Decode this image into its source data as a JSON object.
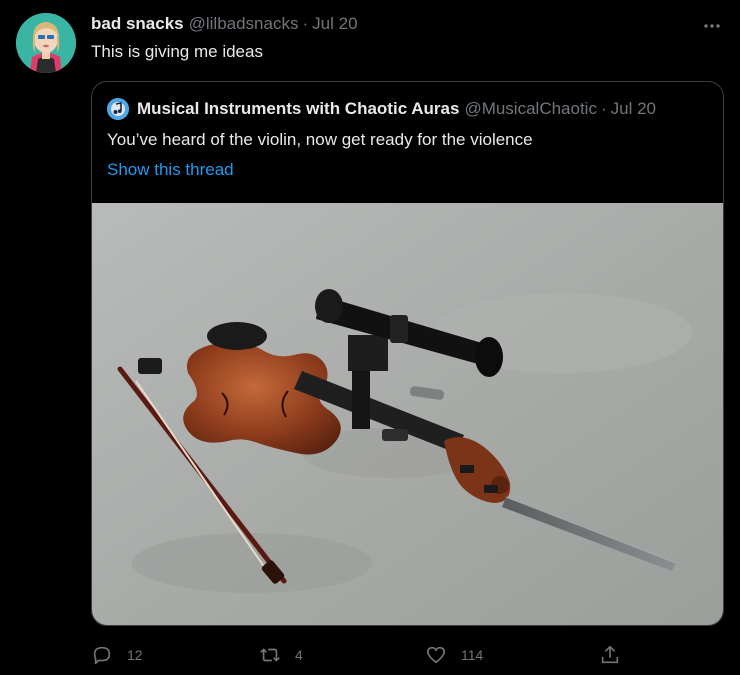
{
  "author": {
    "display_name": "bad snacks",
    "handle": "@lilbadsnacks",
    "separator": "·",
    "date": "Jul 20",
    "avatar_icon": "user-avatar"
  },
  "tweet": {
    "text": "This is giving me ideas"
  },
  "quoted": {
    "display_name": "Musical Instruments with Chaotic Auras",
    "handle": "@MusicalChaotic",
    "separator": "·",
    "date": "Jul 20",
    "text": "You’ve heard of the violin, now get ready for the violence",
    "thread_link": "Show this thread",
    "media_icon": "violin-with-rifle-scope-and-bayonet-photo"
  },
  "actions": {
    "replies": "12",
    "retweets": "4",
    "likes": "114"
  },
  "colors": {
    "background": "#000000",
    "text_primary": "#e7e9ea",
    "text_secondary": "#71767b",
    "link": "#1d9bf0",
    "border": "#3a3d40"
  }
}
